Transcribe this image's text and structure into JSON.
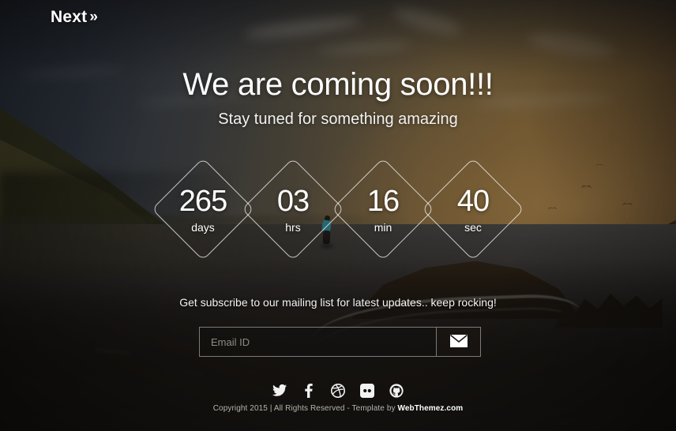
{
  "page": {
    "logo_text": "Next",
    "logo_chevron": "»",
    "headline": "We are coming soon!!!",
    "subheadline": "Stay tuned for something amazing"
  },
  "countdown": {
    "units": [
      {
        "value": "265",
        "label": "days"
      },
      {
        "value": "03",
        "label": "hrs"
      },
      {
        "value": "16",
        "label": "min"
      },
      {
        "value": "40",
        "label": "sec"
      }
    ]
  },
  "subscribe": {
    "prompt": "Get subscribe to our mailing list for latest updates.. keep rocking!",
    "email_value": "",
    "email_placeholder": "Email ID",
    "submit_icon": "envelope-icon"
  },
  "social": {
    "items": [
      {
        "name": "twitter-icon"
      },
      {
        "name": "facebook-icon"
      },
      {
        "name": "dribbble-icon"
      },
      {
        "name": "flickr-icon"
      },
      {
        "name": "github-icon"
      }
    ]
  },
  "footer": {
    "copyright_prefix": "Copyright 2015 | All Rights Reserved - Template by ",
    "brand": "WebThemez.com"
  },
  "colors": {
    "text_primary": "#ffffff",
    "text_muted": "#b6b2ad",
    "outline": "rgba(255,255,255,0.72)",
    "sky_left": "#2c3744",
    "sky_right": "#937542",
    "backdrop": "#15120f"
  }
}
